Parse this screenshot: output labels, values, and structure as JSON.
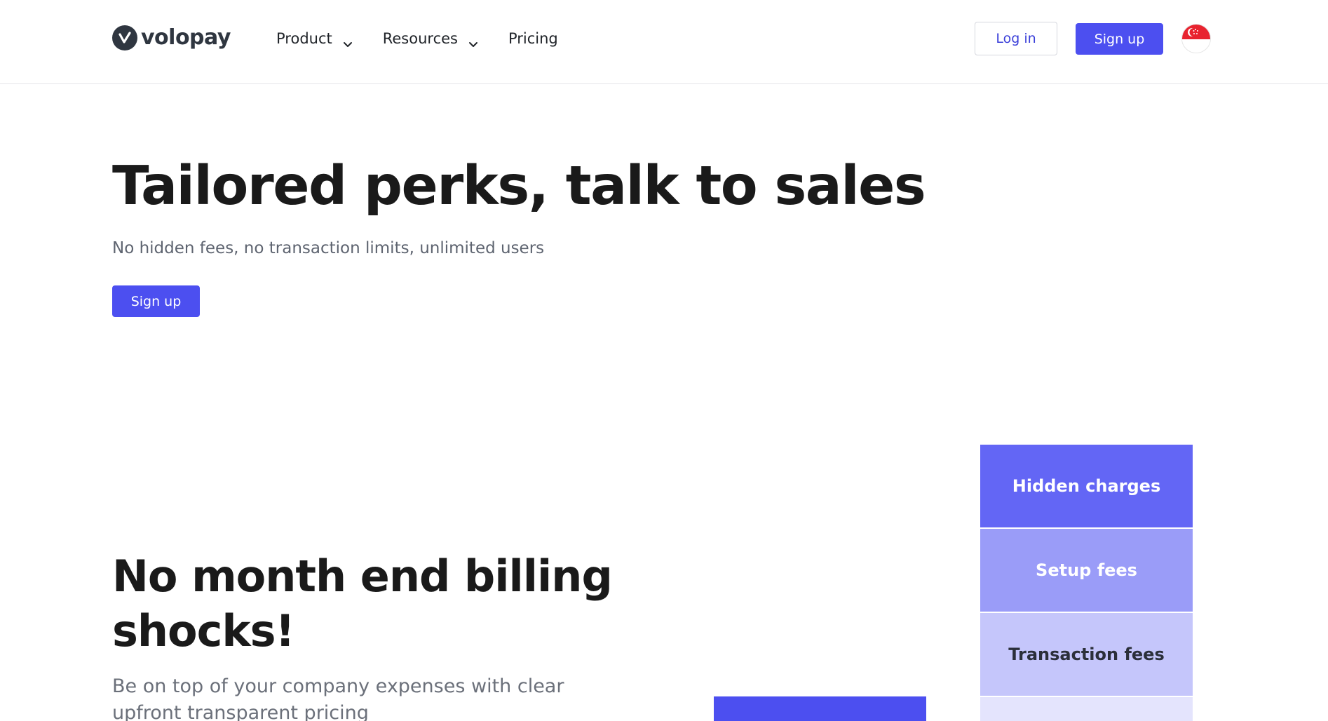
{
  "header": {
    "logo_text": "volopay",
    "nav": [
      {
        "label": "Product",
        "has_dropdown": true
      },
      {
        "label": "Resources",
        "has_dropdown": true
      },
      {
        "label": "Pricing",
        "has_dropdown": false
      }
    ],
    "login_label": "Log in",
    "signup_label": "Sign up",
    "region_flag": "singapore-flag-icon"
  },
  "hero": {
    "title": "Tailored perks, talk to sales",
    "subtitle": "No hidden fees, no transaction limits, unlimited users",
    "signup_label": "Sign up"
  },
  "billing": {
    "title": "No month end billing shocks!",
    "subtitle": "Be on top of your company expenses with clear upfront transparent pricing"
  },
  "fees": [
    "Hidden charges",
    "Setup fees",
    "Transaction fees",
    ""
  ],
  "colors": {
    "brand": "#4c4ff0",
    "text": "#1a1a1a",
    "muted": "#5e6470",
    "fee_1": "#6366f5",
    "fee_2": "#9a9cf8",
    "fee_3": "#c5c6fb",
    "fee_4": "#e4e4fd"
  }
}
